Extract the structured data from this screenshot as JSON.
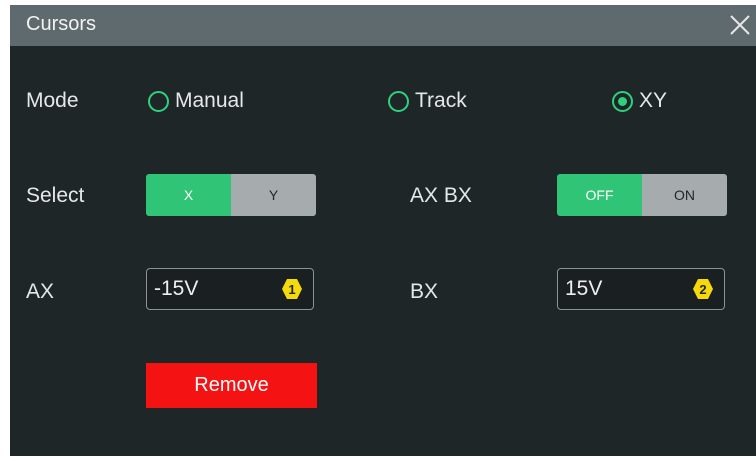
{
  "dialog": {
    "title": "Cursors",
    "close_icon": "close-icon"
  },
  "mode": {
    "label": "Mode",
    "options": [
      {
        "label": "Manual",
        "selected": false
      },
      {
        "label": "Track",
        "selected": false
      },
      {
        "label": "XY",
        "selected": true
      }
    ]
  },
  "select": {
    "label": "Select",
    "options": [
      {
        "label": "X",
        "active": true
      },
      {
        "label": "Y",
        "active": false
      }
    ]
  },
  "axbx": {
    "label": "AX BX",
    "options": [
      {
        "label": "OFF",
        "active": true
      },
      {
        "label": "ON",
        "active": false
      }
    ]
  },
  "ax": {
    "label": "AX",
    "value": "-15V",
    "badge": "1"
  },
  "bx": {
    "label": "BX",
    "value": "15V",
    "badge": "2"
  },
  "remove_label": "Remove",
  "colors": {
    "accent": "#2fc476",
    "badge": "#f5d90a",
    "remove": "#f51212",
    "titlebar": "#5f6a6f",
    "panel": "#1f2628"
  }
}
